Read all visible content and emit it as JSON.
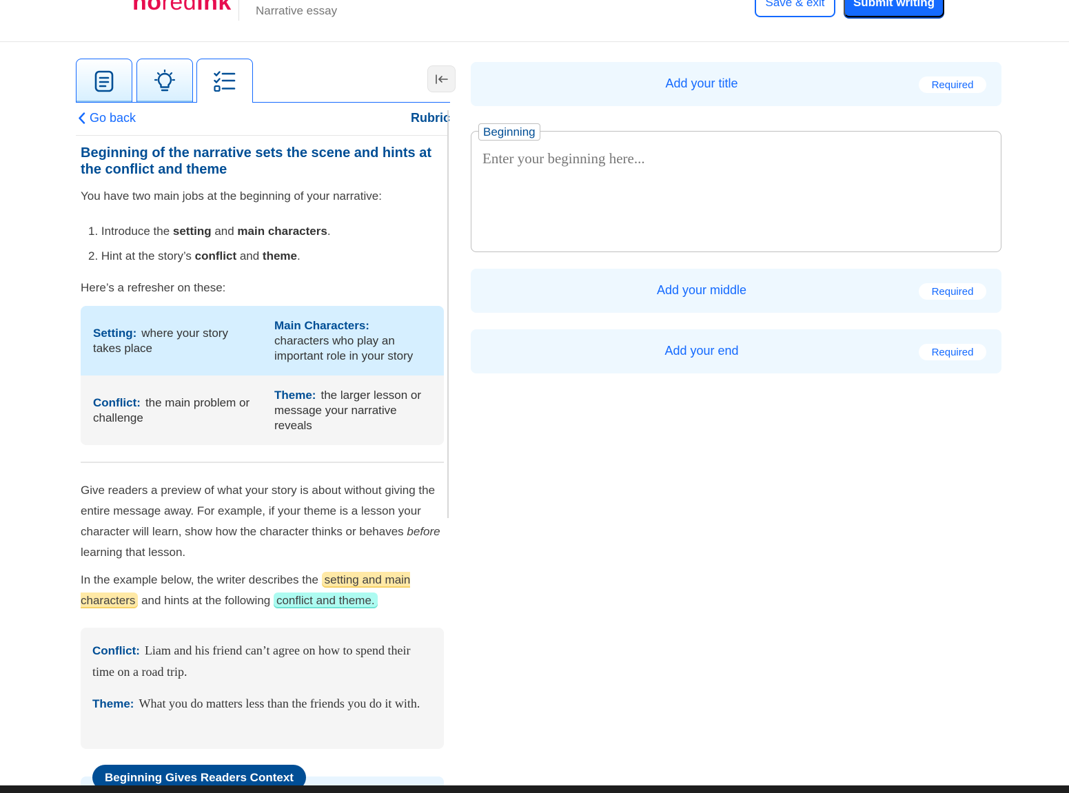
{
  "header": {
    "logo_no": "no",
    "logo_red": "red",
    "logo_ink": "ink",
    "document_type": "Narrative essay",
    "save_exit_label": "Save & exit",
    "submit_label": "Submit writing"
  },
  "sidebar": {
    "tabs": [
      {
        "icon": "document-icon"
      },
      {
        "icon": "lightbulb-icon"
      },
      {
        "icon": "checklist-icon",
        "active": true
      }
    ],
    "collapse_icon": "collapse-left-icon",
    "go_back_label": "Go back",
    "section_label": "Rubric"
  },
  "rubric": {
    "title": "Beginning of the narrative sets the scene and hints at the conflict and theme",
    "intro": "You have two main jobs at the beginning of your narrative:",
    "jobs": [
      {
        "pre": "Introduce the ",
        "b1": "setting",
        "mid": " and ",
        "b2": "main characters",
        "post": "."
      },
      {
        "pre": "Hint at the story’s ",
        "b1": "conflict",
        "mid": " and ",
        "b2": "theme",
        "post": "."
      }
    ],
    "refresher": "Here’s a refresher on these:",
    "definitions": [
      {
        "term": "Setting:",
        "text": "where your story takes place"
      },
      {
        "term": "Main Characters:",
        "text": "characters who play an important role in your story"
      },
      {
        "term": "Conflict:",
        "text": "the main problem or challenge"
      },
      {
        "term": "Theme:",
        "text": "the larger lesson or message your narrative reveals"
      }
    ],
    "preview_pre": "Give readers a preview of what your story is about without giving the entire message away. For example, if your theme is a lesson your character will learn, show how the character thinks or behaves ",
    "preview_em": "before",
    "preview_post": " learning that lesson.",
    "example_pre": "In the example below, the writer describes the ",
    "example_hl1": "setting and main characters",
    "example_mid": " and hints at the following ",
    "example_hl2": "conflict and theme.",
    "example_conflict_term": "Conflict:",
    "example_conflict_text": "Liam and his friend can’t agree on how to spend their time on a road trip.",
    "example_theme_term": "Theme:",
    "example_theme_text": "What you do matters less than the friends you do it with.",
    "context_pill": "Beginning Gives Readers Context"
  },
  "editor": {
    "title_label": "Add your title",
    "required_label": "Required",
    "beginning_legend": "Beginning",
    "beginning_placeholder": "Enter your beginning here...",
    "beginning_value": "",
    "middle_label": "Add your middle",
    "end_label": "Add your end"
  },
  "colors": {
    "brand": "#e70d4f",
    "accent": "#146aff",
    "heading": "#004e95",
    "highlight_yellow": "#ffe9a6",
    "highlight_cyan": "#adfbf1"
  }
}
